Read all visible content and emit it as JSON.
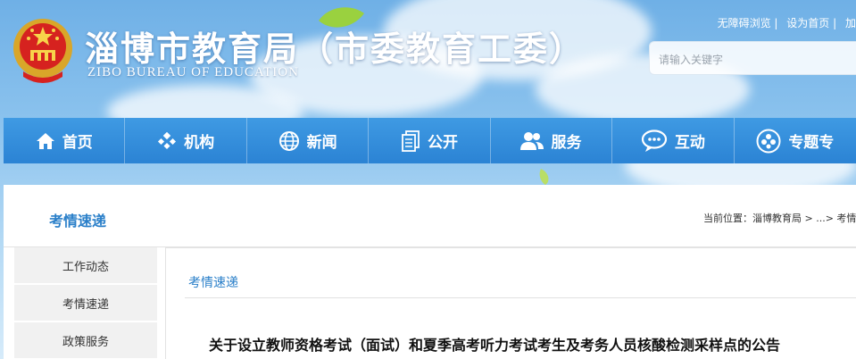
{
  "site": {
    "title": "淄博市教育局（市委教育工委）",
    "subtitle": "ZIBO BUREAU OF EDUCATION"
  },
  "toplinks": [
    "无障碍浏览 |",
    "设为首页 |",
    "加"
  ],
  "search": {
    "placeholder": "请输入关键字"
  },
  "nav": [
    {
      "label": "首页",
      "icon": "home-icon"
    },
    {
      "label": "机构",
      "icon": "org-icon"
    },
    {
      "label": "新闻",
      "icon": "globe-icon"
    },
    {
      "label": "公开",
      "icon": "document-icon"
    },
    {
      "label": "服务",
      "icon": "users-icon"
    },
    {
      "label": "互动",
      "icon": "chat-icon"
    },
    {
      "label": "专题专",
      "icon": "special-icon"
    }
  ],
  "section": {
    "title": "考情速递",
    "breadcrumb": "当前位置：淄博教育局 > ...> 考情"
  },
  "sidebar": [
    "工作动态",
    "考情速递",
    "政策服务"
  ],
  "main": {
    "category": "考情速递",
    "article_title": "关于设立教师资格考试（面试）和夏季高考听力考试考生及考务人员核酸检测采样点的公告"
  },
  "colors": {
    "nav_bg": "#2f8bd8",
    "accent": "#2a7fc9"
  }
}
